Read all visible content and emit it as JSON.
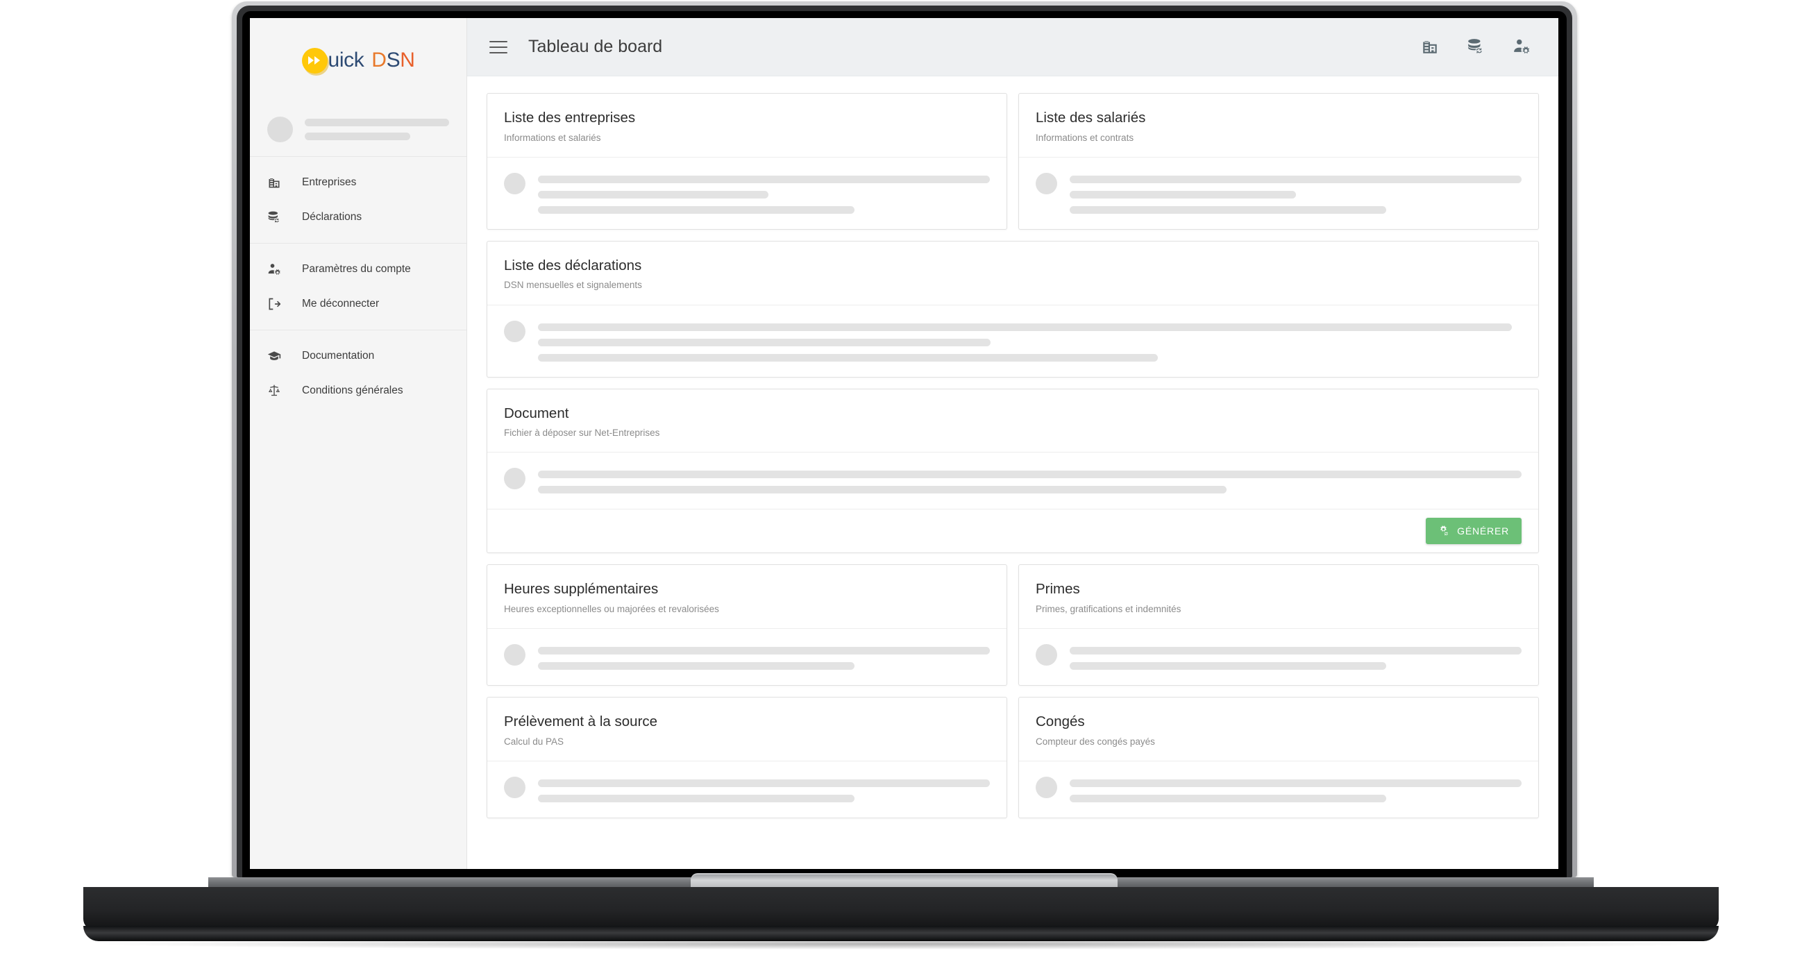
{
  "brand": {
    "mark_icon": "fast-forward-icon",
    "text_uick": "uick",
    "text_d": "D",
    "text_s": "S",
    "text_n": "N",
    "full_name": "Quick DSN",
    "mark_color": "#ffc809",
    "navy_color": "#2d4a73",
    "orange_color": "#e8792b"
  },
  "sidebar": {
    "groups": [
      {
        "items": [
          {
            "label": "Entreprises",
            "icon": "building-icon"
          },
          {
            "label": "Déclarations",
            "icon": "database-sync-icon"
          }
        ]
      },
      {
        "items": [
          {
            "label": "Paramètres du compte",
            "icon": "person-gear-icon"
          },
          {
            "label": "Me déconnecter",
            "icon": "logout-icon"
          }
        ]
      },
      {
        "items": [
          {
            "label": "Documentation",
            "icon": "graduation-cap-icon"
          },
          {
            "label": "Conditions générales",
            "icon": "scales-of-justice-icon"
          }
        ]
      }
    ]
  },
  "topbar": {
    "menu_icon": "hamburger-menu-icon",
    "title": "Tableau de board",
    "actions": [
      {
        "icon": "building-icon"
      },
      {
        "icon": "database-sync-icon"
      },
      {
        "icon": "person-gear-icon"
      }
    ]
  },
  "cards": {
    "entreprises": {
      "title": "Liste des entreprises",
      "subtitle": "Informations et salariés"
    },
    "salaries": {
      "title": "Liste des salariés",
      "subtitle": "Informations et contrats"
    },
    "declarations": {
      "title": "Liste des déclarations",
      "subtitle": "DSN mensuelles et signalements"
    },
    "document": {
      "title": "Document",
      "subtitle": "Fichier à déposer sur Net-Entreprises",
      "action_label": "GÉNÉRER",
      "action_icon": "gear-sync-icon",
      "action_color": "#6cc077"
    },
    "heures": {
      "title": "Heures supplémentaires",
      "subtitle": "Heures exceptionnelles ou majorées et revalorisées"
    },
    "primes": {
      "title": "Primes",
      "subtitle": "Primes, gratifications et indemnités"
    },
    "pas": {
      "title": "Prélèvement à la source",
      "subtitle": "Calcul du PAS"
    },
    "conges": {
      "title": "Congés",
      "subtitle": "Compteur des congés payés"
    }
  }
}
